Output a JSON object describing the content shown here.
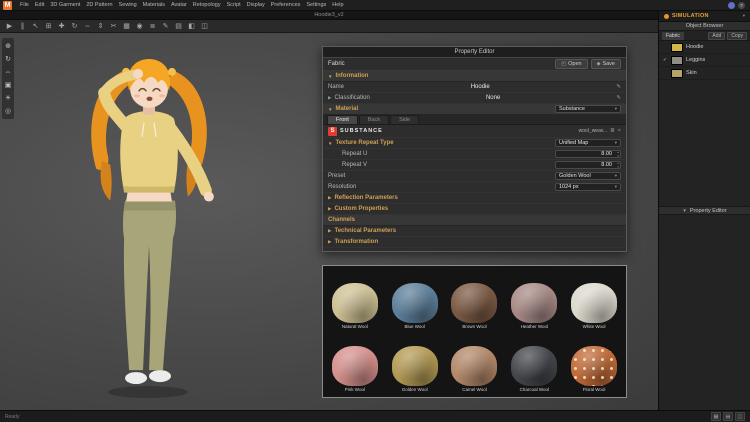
{
  "app": {
    "logo_letter": "M",
    "menus": [
      "File",
      "Edit",
      "3D Garment",
      "2D Pattern",
      "Sewing",
      "Materials",
      "Avatar",
      "Retopology",
      "Script",
      "Display",
      "Preferences",
      "Settings",
      "Help"
    ],
    "document_title": "Hoodie3_v2",
    "help_glyph": "?"
  },
  "glyphs": {
    "caret_down": "▼",
    "caret_right": "▶",
    "dropdown": "▾",
    "pencil": "✎",
    "check": "✓",
    "open_icon": "◰",
    "save_icon": "◆",
    "spin_up": "▴",
    "spin_down": "▾",
    "close": "×",
    "sliders": "≣",
    "view_grid": "▦",
    "view_layers": "▤",
    "view_split": "◫",
    "substance_letter": "S"
  },
  "toolbar": {
    "icons": [
      {
        "name": "simulate",
        "glyph": "▶"
      },
      {
        "name": "pause",
        "glyph": "∥"
      },
      {
        "name": "select",
        "glyph": "↖"
      },
      {
        "name": "box-select",
        "glyph": "⊞"
      },
      {
        "name": "add-point",
        "glyph": "✚"
      },
      {
        "name": "rotate",
        "glyph": "↻"
      },
      {
        "name": "move-horizontal",
        "glyph": "⇔"
      },
      {
        "name": "move-vertical",
        "glyph": "⇕"
      },
      {
        "name": "scissors",
        "glyph": "✂"
      },
      {
        "name": "grid",
        "glyph": "▦"
      },
      {
        "name": "target",
        "glyph": "◉"
      },
      {
        "name": "list",
        "glyph": "≣"
      },
      {
        "name": "edit",
        "glyph": "✎"
      },
      {
        "name": "layers",
        "glyph": "▤"
      },
      {
        "name": "half-view",
        "glyph": "◧"
      },
      {
        "name": "split-view",
        "glyph": "◫"
      }
    ]
  },
  "left_tools": {
    "icons": [
      {
        "name": "gizmo-move",
        "glyph": "⊕"
      },
      {
        "name": "gizmo-rotate",
        "glyph": "↻"
      },
      {
        "name": "gizmo-scale",
        "glyph": "⇔"
      },
      {
        "name": "show-avatar",
        "glyph": "▣"
      },
      {
        "name": "light",
        "glyph": "☀"
      },
      {
        "name": "camera",
        "glyph": "◎"
      }
    ]
  },
  "simulation": {
    "label": "SIMULATION"
  },
  "property_editor": {
    "title": "Property Editor",
    "fabric_label": "Fabric",
    "open_button": "Open",
    "save_button": "Save",
    "information_header": "Information",
    "name_label": "Name",
    "name_value": "Hoodie",
    "classification_label": "Classification",
    "classification_value": "None",
    "material_header": "Material",
    "material_type": "Substance",
    "tabs": [
      {
        "label": "Front"
      },
      {
        "label": "Back"
      },
      {
        "label": "Side"
      }
    ],
    "substance_brand": "SUBSTANCE",
    "substance_file": "wool_weav...",
    "texture_repeat_label": "Texture Repeat Type",
    "texture_repeat_value": "Unified Map",
    "repeat_u_label": "Repeat U",
    "repeat_u_value": "8.00",
    "repeat_v_label": "Repeat V",
    "repeat_v_value": "8.00",
    "preset_label": "Preset",
    "preset_value": "Golden Wool",
    "resolution_label": "Resolution",
    "resolution_value": "1024 px",
    "reflection_header": "Reflection Parameters",
    "custom_header": "Custom Properties",
    "channels_header": "Channels",
    "technical_header": "Technical Parameters",
    "transformation_header": "Transformation"
  },
  "presets": {
    "items": [
      {
        "name": "Natural Wool",
        "color": "#cdc093"
      },
      {
        "name": "Blue Wool",
        "color": "#5d7f9a"
      },
      {
        "name": "Brown Wool",
        "color": "#7b5a43"
      },
      {
        "name": "Heather Wool",
        "color": "#a78a86"
      },
      {
        "name": "White Wool",
        "color": "#dbd8cd"
      },
      {
        "name": "Pink Wool",
        "color": "#d4908c"
      },
      {
        "name": "Golden Wool",
        "color": "#b39a54"
      },
      {
        "name": "Camel Wool",
        "color": "#b3886a"
      },
      {
        "name": "Charcoal Wool",
        "color": "#43464b"
      },
      {
        "name": "Floral Wool",
        "color": "#c06a38",
        "pattern": true
      }
    ]
  },
  "object_browser": {
    "title": "Object Browser",
    "tab_label": "Fabric",
    "add_button": "Add",
    "copy_button": "Copy",
    "items": [
      {
        "name": "Hoodie",
        "color": "#d2b64a",
        "checked": false
      },
      {
        "name": "Leggins",
        "color": "#8e8e86",
        "checked": true
      },
      {
        "name": "Skin",
        "color": "#b4a36b",
        "checked": false
      }
    ],
    "lower_header": "Property Editor"
  },
  "statusbar": {
    "left_text": "Ready"
  }
}
